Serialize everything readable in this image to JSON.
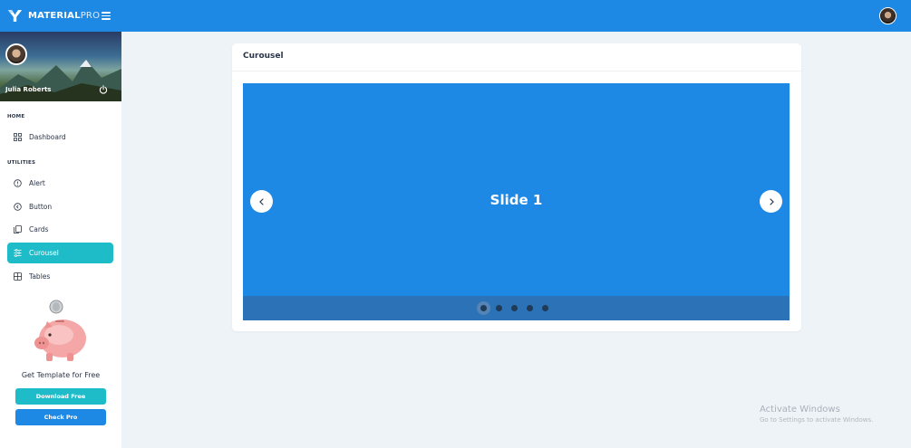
{
  "app": {
    "brand_bold": "MATERIAL",
    "brand_light": "PRO"
  },
  "profile": {
    "name": "Julia Roberts"
  },
  "sidebar": {
    "sections": [
      {
        "label": "HOME"
      },
      {
        "label": "UTILITIES"
      }
    ],
    "items": [
      {
        "label": "Dashboard",
        "icon": "grid-icon"
      },
      {
        "label": "Alert",
        "icon": "info-circle-icon"
      },
      {
        "label": "Button",
        "icon": "circle-arrow-icon"
      },
      {
        "label": "Cards",
        "icon": "cards-icon"
      },
      {
        "label": "Curousel",
        "icon": "sliders-icon",
        "active": true
      },
      {
        "label": "Tables",
        "icon": "table-icon"
      }
    ],
    "promo": {
      "text": "Get Template for Free",
      "download_label": "Download Free",
      "pro_label": "Check Pro"
    }
  },
  "main": {
    "card_title": "Curousel",
    "carousel": {
      "slide_text": "Slide 1",
      "indicator_count": 5,
      "active_index": 0
    }
  },
  "watermark": {
    "title": "Activate Windows",
    "subtitle": "Go to Settings to activate Windows."
  },
  "colors": {
    "primary": "#1e88e5",
    "accent": "#1ebcc8",
    "background": "#eef3f8"
  }
}
